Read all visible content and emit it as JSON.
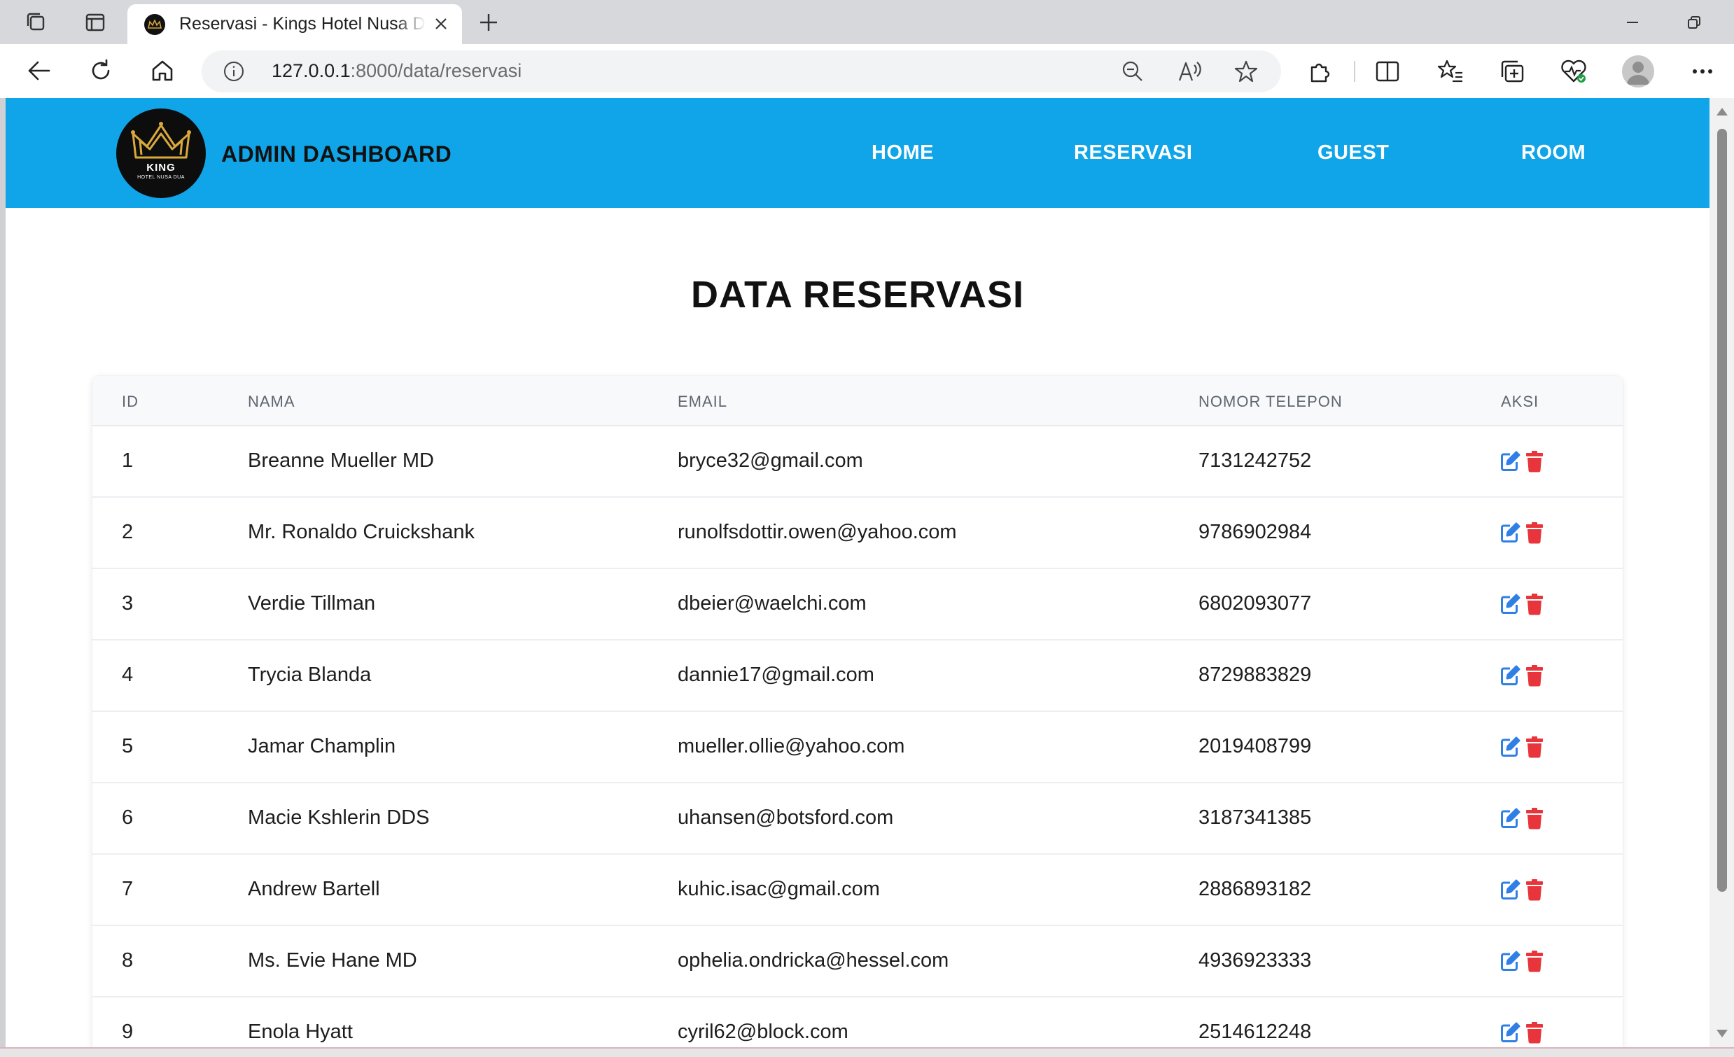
{
  "browser": {
    "tab_title": "Reservasi - Kings Hotel Nusa Dua",
    "url_host": "127.0.0.1",
    "url_path": ":8000/data/reservasi"
  },
  "header": {
    "brand": "ADMIN DASHBOARD",
    "logo_text": "KING",
    "logo_subtext": "HOTEL NUSA DUA",
    "nav": [
      "HOME",
      "RESERVASI",
      "GUEST",
      "ROOM"
    ],
    "bg_color": "#10a5e8"
  },
  "page_title": "DATA RESERVASI",
  "table": {
    "columns": [
      "ID",
      "NAMA",
      "EMAIL",
      "NOMOR TELEPON",
      "AKSI"
    ],
    "rows": [
      {
        "id": "1",
        "nama": "Breanne Mueller MD",
        "email": "bryce32@gmail.com",
        "telepon": "7131242752"
      },
      {
        "id": "2",
        "nama": "Mr. Ronaldo Cruickshank",
        "email": "runolfsdottir.owen@yahoo.com",
        "telepon": "9786902984"
      },
      {
        "id": "3",
        "nama": "Verdie Tillman",
        "email": "dbeier@waelchi.com",
        "telepon": "6802093077"
      },
      {
        "id": "4",
        "nama": "Trycia Blanda",
        "email": "dannie17@gmail.com",
        "telepon": "8729883829"
      },
      {
        "id": "5",
        "nama": "Jamar Champlin",
        "email": "mueller.ollie@yahoo.com",
        "telepon": "2019408799"
      },
      {
        "id": "6",
        "nama": "Macie Kshlerin DDS",
        "email": "uhansen@botsford.com",
        "telepon": "3187341385"
      },
      {
        "id": "7",
        "nama": "Andrew Bartell",
        "email": "kuhic.isac@gmail.com",
        "telepon": "2886893182"
      },
      {
        "id": "8",
        "nama": "Ms. Evie Hane MD",
        "email": "ophelia.ondricka@hessel.com",
        "telepon": "4936923333"
      },
      {
        "id": "9",
        "nama": "Enola Hyatt",
        "email": "cyril62@block.com",
        "telepon": "2514612248"
      }
    ],
    "actions": {
      "edit_icon": "edit-icon",
      "delete_icon": "trash-icon",
      "edit_color": "#2f7fe6",
      "delete_color": "#e8343b"
    }
  }
}
